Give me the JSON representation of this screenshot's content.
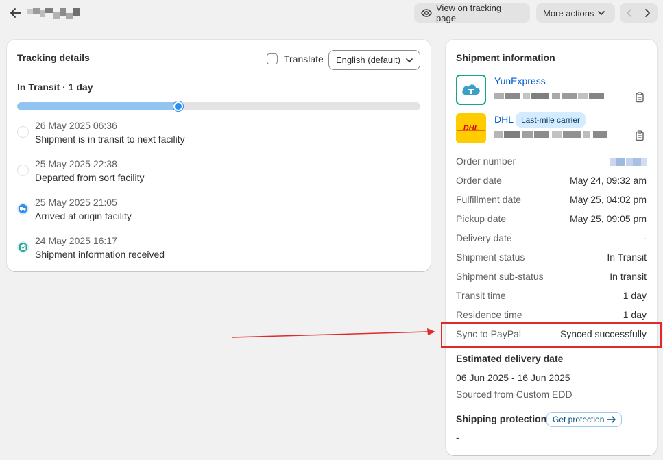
{
  "header": {
    "view_tracking_label": "View on tracking page",
    "more_actions_label": "More actions"
  },
  "tracking": {
    "title": "Tracking details",
    "translate_label": "Translate",
    "translate_checked": false,
    "language": "English (default)",
    "status": "In Transit · 1 day",
    "progress_percent": 40,
    "events": [
      {
        "time": "26 May 2025 06:36",
        "description": "Shipment is in transit to next facility",
        "icon": "empty-circle"
      },
      {
        "time": "25 May 2025 22:38",
        "description": "Departed from sort facility",
        "icon": "empty-circle"
      },
      {
        "time": "25 May 2025 21:05",
        "description": "Arrived at origin facility",
        "icon": "truck-icon"
      },
      {
        "time": "24 May 2025 16:17",
        "description": "Shipment information received",
        "icon": "clipboard-icon"
      }
    ]
  },
  "shipment": {
    "title": "Shipment information",
    "carriers": [
      {
        "name": "YunExpress",
        "badge": "",
        "logo": "yunexpress-logo"
      },
      {
        "name": "DHL",
        "badge": "Last-mile carrier",
        "logo": "dhl-logo"
      }
    ],
    "rows": [
      {
        "label": "Order number",
        "value": ""
      },
      {
        "label": "Order date",
        "value": "May 24, 09:32 am"
      },
      {
        "label": "Fulfillment date",
        "value": "May 25, 04:02 pm"
      },
      {
        "label": "Pickup date",
        "value": "May 25, 09:05 pm"
      },
      {
        "label": "Delivery date",
        "value": "-"
      },
      {
        "label": "Shipment status",
        "value": "In Transit"
      },
      {
        "label": "Shipment sub-status",
        "value": "In transit"
      },
      {
        "label": "Transit time",
        "value": "1 day"
      },
      {
        "label": "Residence time",
        "value": "1 day"
      },
      {
        "label": "Sync to PayPal",
        "value": "Synced successfully"
      }
    ],
    "edd_title": "Estimated delivery date",
    "edd_range": "06 Jun 2025 - 16 Jun 2025",
    "edd_source": "Sourced from Custom EDD",
    "protection_title": "Shipping protection",
    "protection_button": "Get protection",
    "protection_value": "-"
  },
  "colors": {
    "accent_blue": "#2c8ef0",
    "link_blue": "#005bd3",
    "highlight_red": "#e02a2a",
    "dhl_yellow": "#ffcc00",
    "dhl_red": "#d40511"
  }
}
